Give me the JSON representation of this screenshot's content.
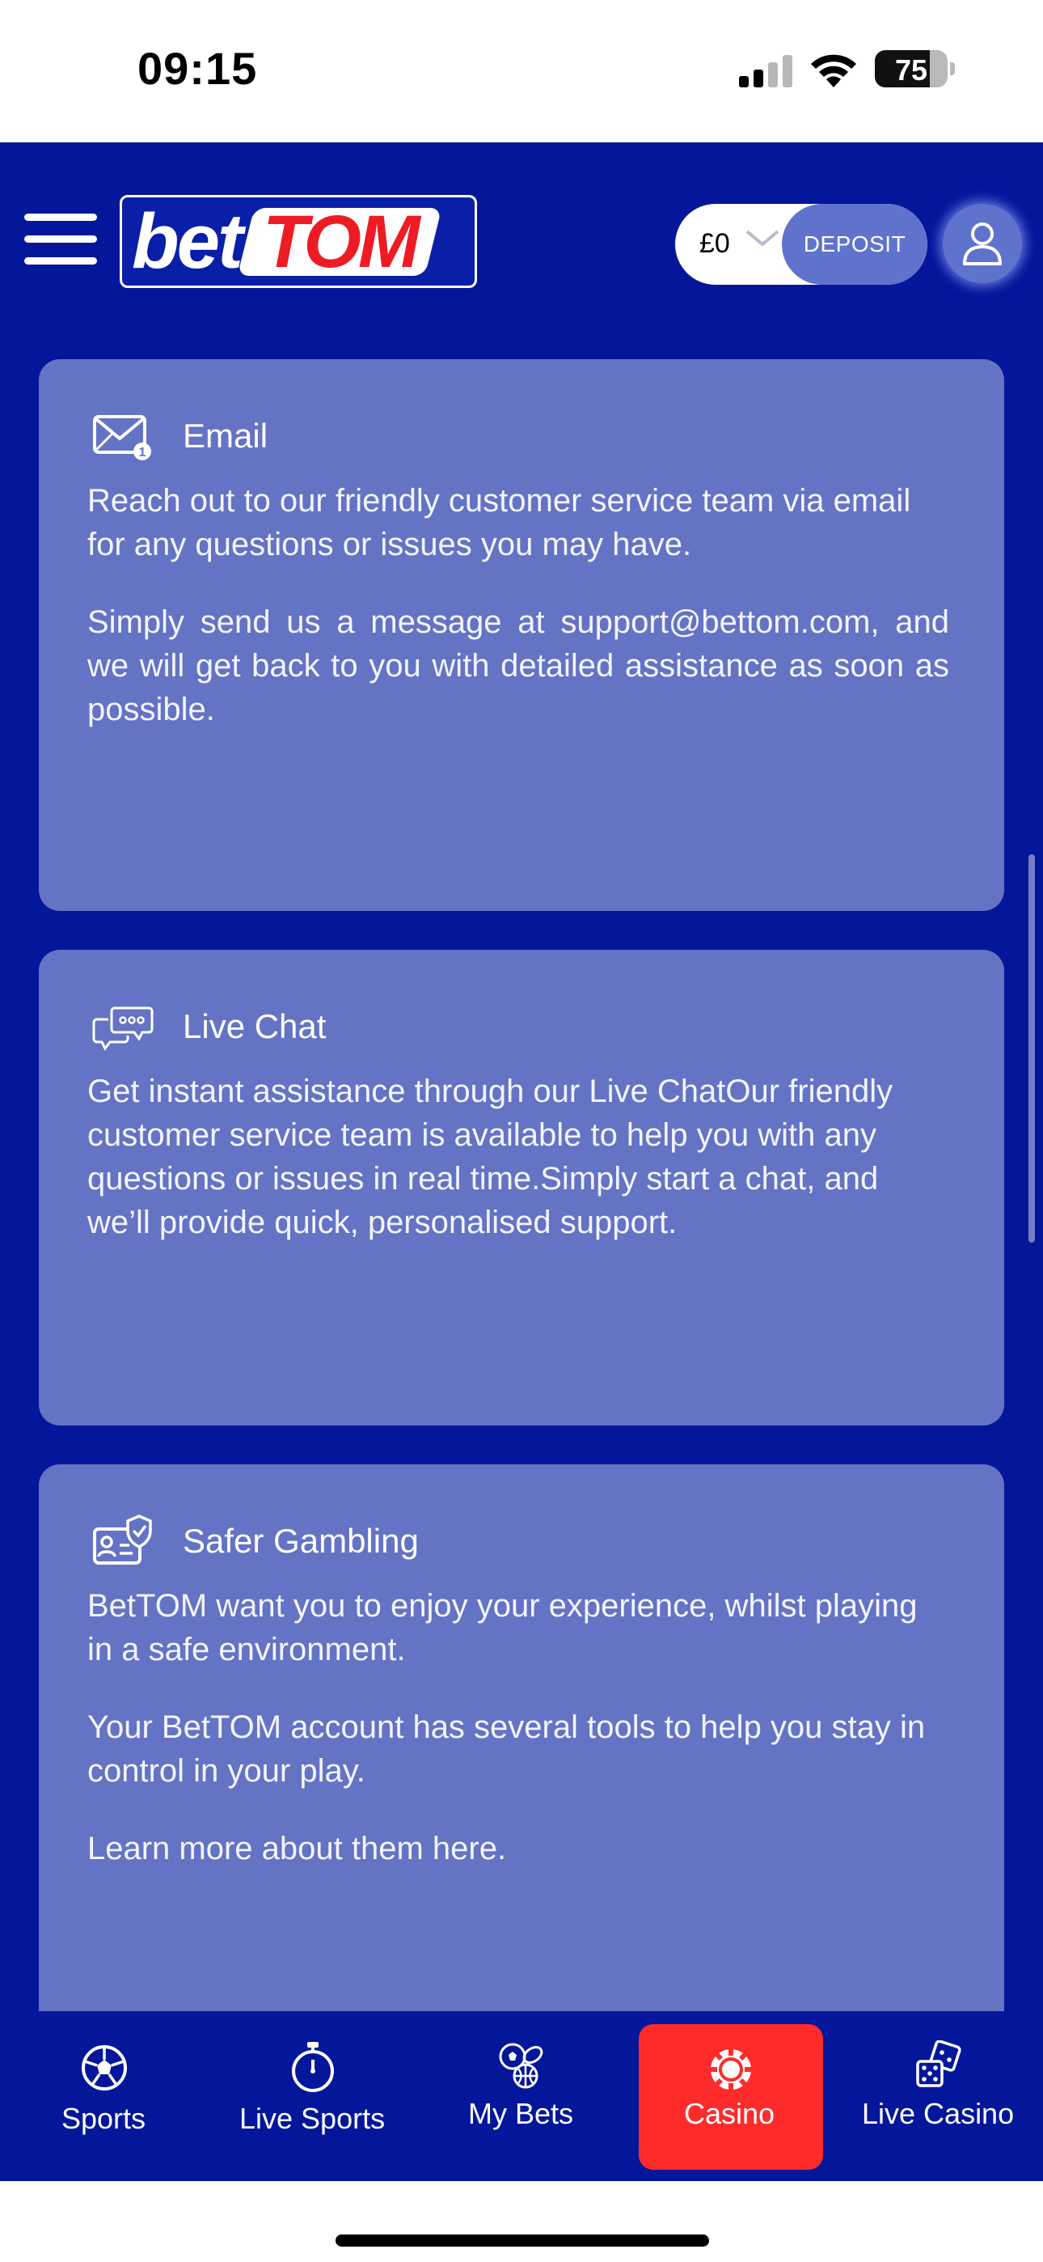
{
  "status_bar": {
    "time": "09:15",
    "battery": "75",
    "battery_level_percent": 75
  },
  "header": {
    "menu_icon": "hamburger-menu-icon",
    "logo_text_bet": "bet",
    "logo_text_tom": "TOM",
    "balance": "£0",
    "deposit_label": "DEPOSIT",
    "account_icon": "user-icon"
  },
  "cards": {
    "email": {
      "icon": "envelope-icon",
      "title": "Email",
      "para1": "Reach out to our friendly customer service team via email for any questions or issues you may have.",
      "para2": "Simply send us a message at support@bettom.com, and we will get back to you with detailed assistance as soon as possible."
    },
    "live_chat": {
      "icon": "chat-bubbles-icon",
      "title": "Live Chat",
      "para1": "Get instant assistance through our Live ChatOur friendly customer service team is available to help you with any questions or issues in real time.Simply start a chat, and we’ll provide quick, personalised support."
    },
    "safer_gambling": {
      "icon": "id-card-shield-icon",
      "title": "Safer Gambling",
      "para1": "BetTOM want you to enjoy your experience, whilst playing in a safe environment.",
      "para2": "Your BetTOM account has several tools to help you stay in control in your play.",
      "para3": "Learn more about them here."
    }
  },
  "bottom_nav": {
    "items": [
      {
        "label": "Sports",
        "icon": "football-icon"
      },
      {
        "label": "Live Sports",
        "icon": "stopwatch-icon"
      },
      {
        "label": "My Bets",
        "icon": "sports-balls-icon"
      },
      {
        "label": "Casino",
        "icon": "casino-chip-icon",
        "active": true
      },
      {
        "label": "Live Casino",
        "icon": "dice-icon"
      }
    ]
  },
  "colors": {
    "app_background": "#04179b",
    "card_background": "#6473c3",
    "deposit_button": "#5f73cd",
    "active_tab": "#ff2b2b"
  }
}
